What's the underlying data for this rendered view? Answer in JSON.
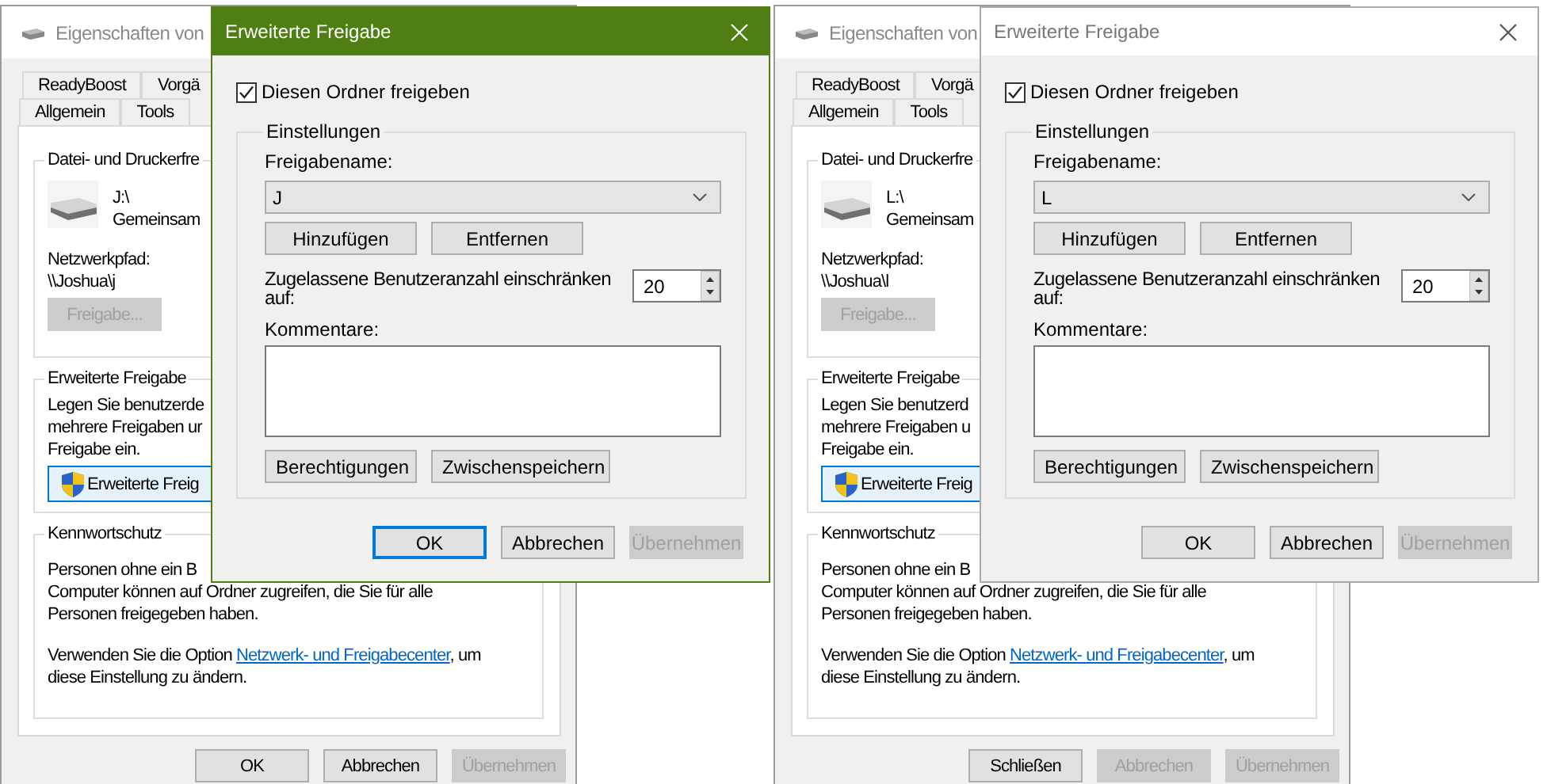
{
  "panels": [
    {
      "properties": {
        "title": "Eigenschaften von",
        "tab_rows": [
          [
            {
              "label": "ReadyBoost",
              "selected": false
            },
            {
              "label": "Vorgä",
              "selected": false
            }
          ],
          [
            {
              "label": "Allgemein",
              "selected": false
            },
            {
              "label": "Tools",
              "selected": false
            }
          ]
        ],
        "sharing": {
          "title": "Datei- und Druckerfre",
          "drive": "J:\\",
          "drive_status": "Gemeinsam",
          "path_label": "Netzwerkpfad:",
          "path": "\\\\Joshua\\j",
          "button": {
            "label": "Freigabe...",
            "disabled": true
          }
        },
        "advanced": {
          "title": "Erweiterte Freigabe",
          "lines": [
            "Legen Sie benutzerde",
            "mehrere Freigaben ur",
            "Freigabe ein."
          ],
          "button": "Erweiterte Freig"
        },
        "password": {
          "title": "Kennwortschutz",
          "lines": [
            "Personen ohne ein B",
            "Computer können auf Ordner zugreifen, die Sie für alle",
            "Personen freigegeben haben."
          ],
          "hint_before": "Verwenden Sie die Option",
          "link": "Netzwerk- und Freigabecenter",
          "hint_after": ", um",
          "hint_line2": "diese Einstellung zu ändern."
        },
        "buttons": [
          {
            "label": "OK",
            "disabled": false
          },
          {
            "label": "Abbrechen",
            "disabled": false
          },
          {
            "label": "Übernehmen",
            "disabled": true
          }
        ]
      },
      "dialog": {
        "title": "Erweiterte Freigabe",
        "active": true,
        "checkbox": {
          "label": "Diesen Ordner freigeben",
          "checked": true
        },
        "group": "Einstellungen",
        "name_label": "Freigabename:",
        "name_value": "J",
        "name_buttons": [
          "Hinzufügen",
          "Entfernen"
        ],
        "limit_label": "Zugelassene Benutzeranzahl einschränken auf:",
        "limit_value": "20",
        "comments_label": "Kommentare:",
        "extra_buttons": [
          "Berechtigungen",
          "Zwischenspeichern"
        ],
        "buttons": [
          {
            "label": "OK",
            "disabled": false,
            "focused": true
          },
          {
            "label": "Abbrechen",
            "disabled": false,
            "focused": false
          },
          {
            "label": "Übernehmen",
            "disabled": true,
            "focused": false
          }
        ]
      }
    },
    {
      "properties": {
        "title": "Eigenschaften von",
        "tab_rows": [
          [
            {
              "label": "ReadyBoost",
              "selected": false
            },
            {
              "label": "Vorgä",
              "selected": false
            }
          ],
          [
            {
              "label": "Allgemein",
              "selected": false
            },
            {
              "label": "Tools",
              "selected": false
            }
          ]
        ],
        "sharing": {
          "title": "Datei- und Druckerfre",
          "drive": "L:\\",
          "drive_status": "Gemeinsam",
          "path_label": "Netzwerkpfad:",
          "path": "\\\\Joshua\\l",
          "button": {
            "label": "Freigabe...",
            "disabled": true
          }
        },
        "advanced": {
          "title": "Erweiterte Freigabe",
          "lines": [
            "Legen Sie benutzerd",
            "mehrere Freigaben u",
            "Freigabe ein."
          ],
          "button": "Erweiterte Freig"
        },
        "password": {
          "title": "Kennwortschutz",
          "lines": [
            "Personen ohne ein B",
            "Computer können auf Ordner zugreifen, die Sie für alle",
            "Personen freigegeben haben."
          ],
          "hint_before": "Verwenden Sie die Option",
          "link": "Netzwerk- und Freigabecenter",
          "hint_after": ", um",
          "hint_line2": "diese Einstellung zu ändern."
        },
        "buttons": [
          {
            "label": "Schließen",
            "disabled": false
          },
          {
            "label": "Abbrechen",
            "disabled": true
          },
          {
            "label": "Übernehmen",
            "disabled": true
          }
        ]
      },
      "dialog": {
        "title": "Erweiterte Freigabe",
        "active": false,
        "checkbox": {
          "label": "Diesen Ordner freigeben",
          "checked": true
        },
        "group": "Einstellungen",
        "name_label": "Freigabename:",
        "name_value": "L",
        "name_buttons": [
          "Hinzufügen",
          "Entfernen"
        ],
        "limit_label": "Zugelassene Benutzeranzahl einschränken auf:",
        "limit_value": "20",
        "comments_label": "Kommentare:",
        "extra_buttons": [
          "Berechtigungen",
          "Zwischenspeichern"
        ],
        "buttons": [
          {
            "label": "OK",
            "disabled": false,
            "focused": false
          },
          {
            "label": "Abbrechen",
            "disabled": false,
            "focused": false
          },
          {
            "label": "Übernehmen",
            "disabled": true,
            "focused": false
          }
        ]
      }
    }
  ]
}
